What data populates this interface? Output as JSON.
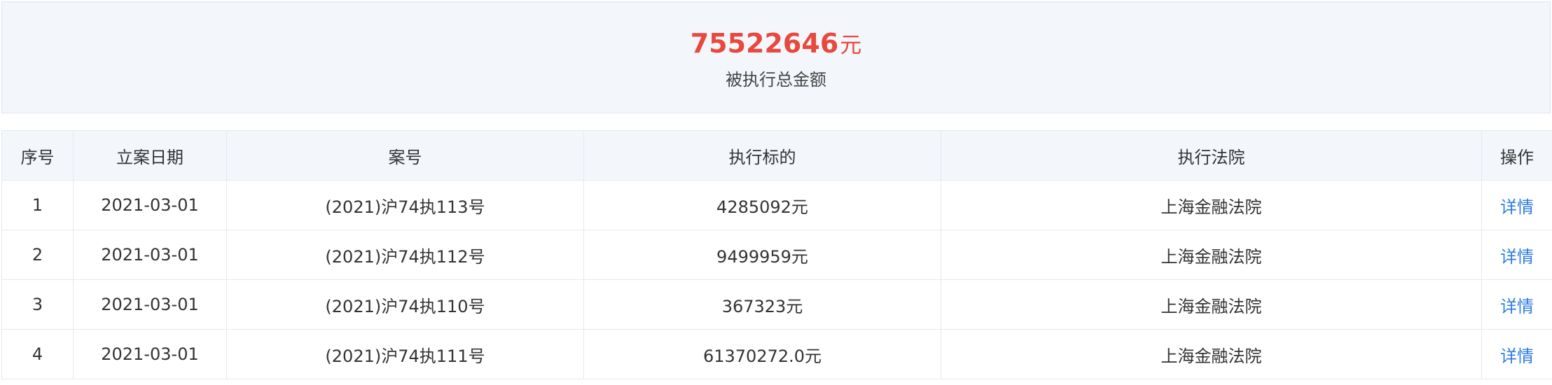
{
  "summary": {
    "amount": "75522646",
    "unit": "元",
    "caption": "被执行总金额",
    "amount_color": "#e8483d"
  },
  "table": {
    "columns": [
      "序号",
      "立案日期",
      "案号",
      "执行标的",
      "执行法院",
      "操作"
    ],
    "rows": [
      {
        "index": "1",
        "date": "2021-03-01",
        "case_no": "(2021)沪74执113号",
        "target": "4285092元",
        "court": "上海金融法院",
        "action": "详情"
      },
      {
        "index": "2",
        "date": "2021-03-01",
        "case_no": "(2021)沪74执112号",
        "target": "9499959元",
        "court": "上海金融法院",
        "action": "详情"
      },
      {
        "index": "3",
        "date": "2021-03-01",
        "case_no": "(2021)沪74执110号",
        "target": "367323元",
        "court": "上海金融法院",
        "action": "详情"
      },
      {
        "index": "4",
        "date": "2021-03-01",
        "case_no": "(2021)沪74执111号",
        "target": "61370272.0元",
        "court": "上海金融法院",
        "action": "详情"
      }
    ]
  },
  "colors": {
    "link": "#2e7de0",
    "header_bg": "#f3f7fc",
    "border": "#e3eaf2"
  }
}
